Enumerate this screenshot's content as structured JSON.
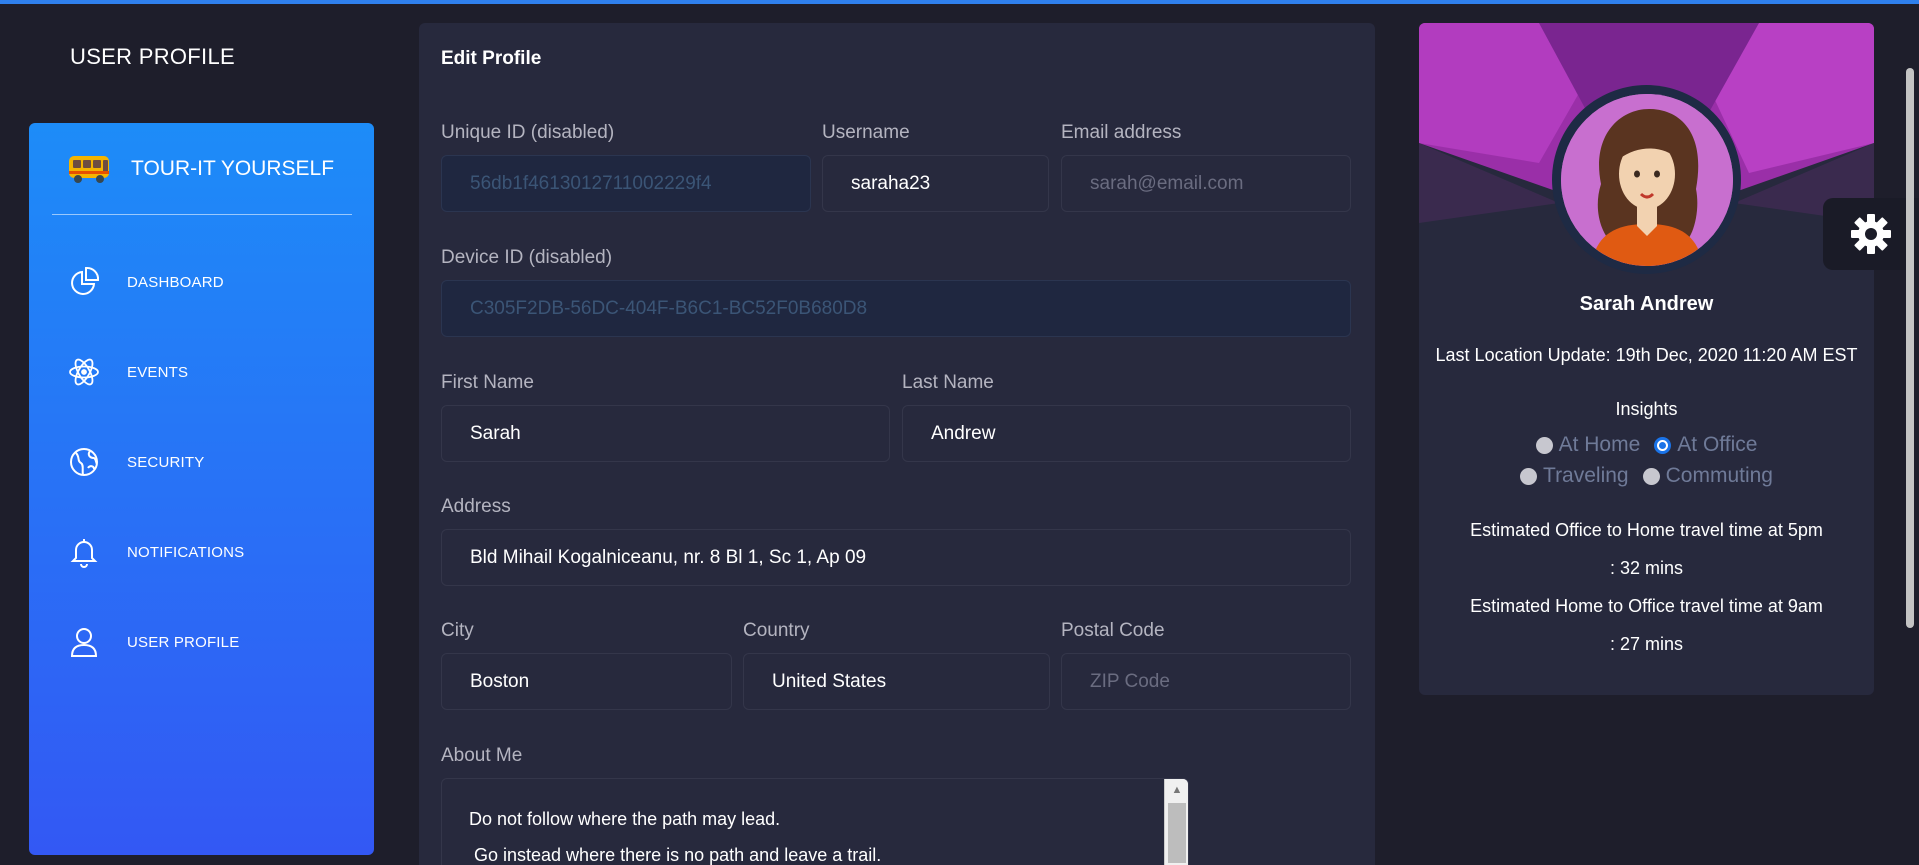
{
  "header": {
    "page_title": "USER PROFILE"
  },
  "sidebar": {
    "brand": "TOUR-IT YOURSELF",
    "items": [
      {
        "label": "DASHBOARD",
        "icon": "pie-chart-icon"
      },
      {
        "label": "EVENTS",
        "icon": "atom-icon"
      },
      {
        "label": "SECURITY",
        "icon": "globe-icon"
      },
      {
        "label": "NOTIFICATIONS",
        "icon": "bell-icon"
      },
      {
        "label": "USER PROFILE",
        "icon": "user-icon"
      }
    ]
  },
  "edit_profile": {
    "title": "Edit Profile",
    "unique_id": {
      "label": "Unique ID (disabled)",
      "value": "56db1f4613012711002229f4"
    },
    "username": {
      "label": "Username",
      "value": "saraha23"
    },
    "email": {
      "label": "Email address",
      "placeholder": "sarah@email.com"
    },
    "device_id": {
      "label": "Device ID (disabled)",
      "value": "C305F2DB-56DC-404F-B6C1-BC52F0B680D8"
    },
    "first_name": {
      "label": "First Name",
      "value": "Sarah"
    },
    "last_name": {
      "label": "Last Name",
      "value": "Andrew"
    },
    "address": {
      "label": "Address",
      "value": "Bld Mihail Kogalniceanu, nr. 8 Bl 1, Sc 1, Ap 09"
    },
    "city": {
      "label": "City",
      "value": "Boston"
    },
    "country": {
      "label": "Country",
      "value": "United States"
    },
    "postal_code": {
      "label": "Postal Code",
      "placeholder": "ZIP Code"
    },
    "about_me": {
      "label": "About Me",
      "line1": "Do not follow where the path may lead.",
      "line2": " Go instead where there is no path and leave a trail."
    }
  },
  "profile_card": {
    "name": "Sarah Andrew",
    "last_location": "Last Location Update: 19th Dec, 2020 11:20 AM EST",
    "insights_title": "Insights",
    "insights_options": [
      {
        "label": "At Home",
        "selected": false
      },
      {
        "label": "At Office",
        "selected": true
      },
      {
        "label": "Traveling",
        "selected": false
      },
      {
        "label": "Commuting",
        "selected": false
      }
    ],
    "estimate1_line1": "Estimated Office to Home travel time at 5pm",
    "estimate1_line2": ": 32 mins",
    "estimate2_line1": "Estimated Home to Office travel time at 9am",
    "estimate2_line2": ": 27 mins"
  },
  "colors": {
    "sidebar_top": "#1d8cf8",
    "sidebar_bottom": "#3358f4",
    "card_bg": "#27293d",
    "page_bg": "#1e1e2b",
    "banner_purple": "#b23cbf"
  }
}
